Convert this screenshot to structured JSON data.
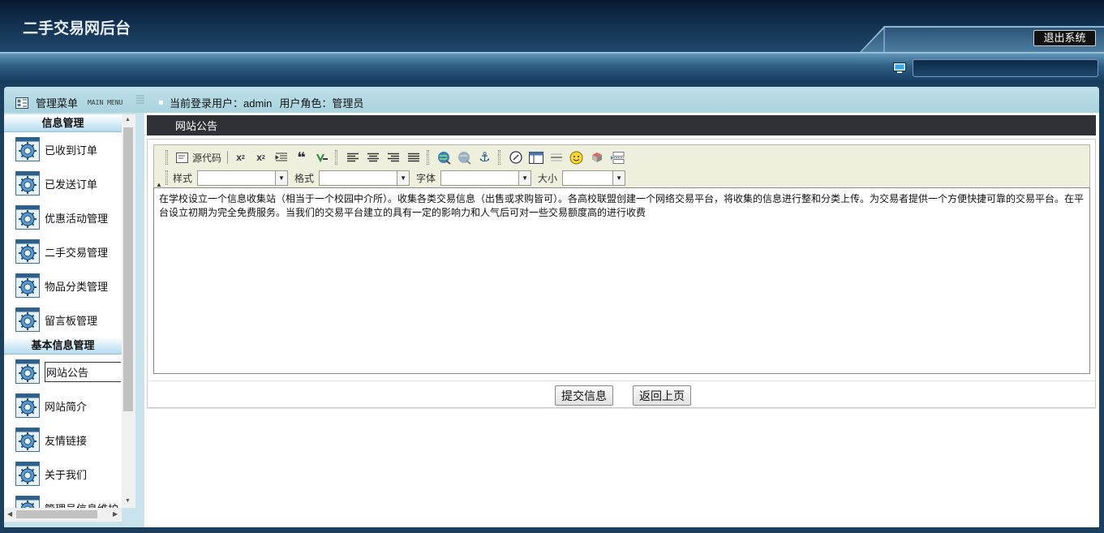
{
  "header": {
    "site_title": "二手交易网后台",
    "logout_label": "退出系统"
  },
  "frame_header": {
    "menu_title": "管理菜单",
    "menu_title_en": "MAIN MENU",
    "login_user": "当前登录用户：admin",
    "login_role": "用户角色：管理员"
  },
  "sidebar": {
    "groups": [
      {
        "title": "信息管理",
        "items": [
          {
            "label": "已收到订单"
          },
          {
            "label": "已发送订单"
          },
          {
            "label": "优惠活动管理"
          },
          {
            "label": "二手交易管理"
          },
          {
            "label": "物品分类管理"
          },
          {
            "label": "留言板管理"
          }
        ]
      },
      {
        "title": "基本信息管理",
        "items": [
          {
            "label": "网站公告"
          },
          {
            "label": "网站简介"
          },
          {
            "label": "友情链接"
          },
          {
            "label": "关于我们"
          },
          {
            "label": "管理员信息维护"
          }
        ]
      }
    ],
    "active_item": "网站公告"
  },
  "content": {
    "title": "网站公告",
    "toolbar": {
      "source_label": "源代码",
      "style_label": "样式",
      "format_label": "格式",
      "font_label": "字体",
      "size_label": "大小",
      "style_value": "",
      "format_value": "",
      "font_value": "",
      "size_value": ""
    },
    "editor_text": "在学校设立一个信息收集站（相当于一个校园中介所）。收集各类交易信息（出售或求购皆可）。各高校联盟创建一个网络交易平台，将收集的信息进行整和分类上传。为交易者提供一个方便快捷可靠的交易平台。在平台设立初期为完全免费服务。当我们的交易平台建立的具有一定的影响力和人气后可对一些交易额度高的进行收费",
    "submit_label": "提交信息",
    "back_label": "返回上页"
  },
  "colors": {
    "header_dark": "#07182f",
    "frame_head": "#bfe0ea",
    "content_title_bg": "#2e3135",
    "toolbar_bg": "#efefde"
  }
}
